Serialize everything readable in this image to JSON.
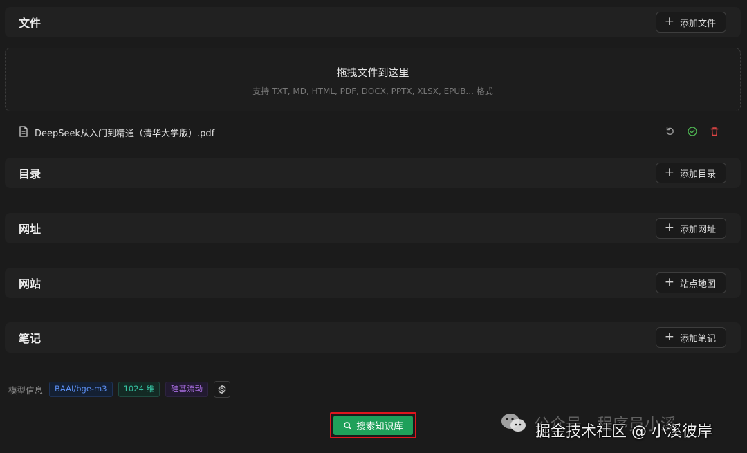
{
  "sections": {
    "files": {
      "title": "文件",
      "button": "添加文件"
    },
    "directory": {
      "title": "目录",
      "button": "添加目录"
    },
    "url": {
      "title": "网址",
      "button": "添加网址"
    },
    "website": {
      "title": "网站",
      "button": "站点地图"
    },
    "notes": {
      "title": "笔记",
      "button": "添加笔记"
    }
  },
  "dropzone": {
    "title": "拖拽文件到这里",
    "subtitle": "支持 TXT, MD, HTML, PDF, DOCX, PPTX, XLSX, EPUB... 格式"
  },
  "file_item": {
    "name": "DeepSeek从入门到精通（清华大学版）.pdf",
    "icons": [
      "file-icon",
      "refresh-icon",
      "check-circle-icon",
      "trash-icon"
    ]
  },
  "model_info": {
    "label": "模型信息",
    "tags": [
      "BAAI/bge-m3",
      "1024 维",
      "硅基流动"
    ]
  },
  "search_button": {
    "label": "搜索知识库"
  },
  "watermark": {
    "back_text": "公众号 · 程序员小溪",
    "front_text": "掘金技术社区 @ 小溪彼岸"
  },
  "colors": {
    "background": "#1b1b1b",
    "section": "#212121",
    "accent_green": "#1fa05a",
    "highlight_red": "#e0161e",
    "tag_blue": "#5b8def",
    "tag_green": "#36c2a1",
    "tag_purple": "#a86de0",
    "delete_red": "#e04545"
  }
}
